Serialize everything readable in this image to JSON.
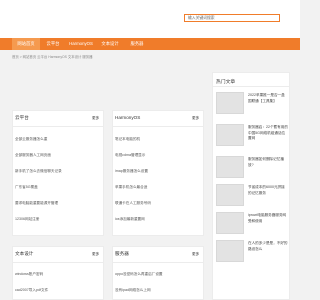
{
  "search": {
    "placeholder": "输入关键词搜索"
  },
  "nav": {
    "items": [
      "网站首页",
      "云平台",
      "HarmonyOS",
      "文本设计",
      "服务器"
    ],
    "active_index": 0,
    "accent": "#f07c2a"
  },
  "breadcrumb": "首页 > 网站首页 云平台 HarmonyOS 文本设计 服务器",
  "panels": {
    "cloud": {
      "title": "云平台",
      "more": "更多",
      "items": [
        "全部云服务器怎么重",
        "全部服务器人工网页面",
        "新手机了怎么去微信聊天记录",
        "广东省5G覆盖",
        "要求电脑能重要能源开管理",
        "12306网站注册"
      ]
    },
    "harmony": {
      "title": "HarmonyOS",
      "more": "更多",
      "items": [
        "笔记本电脑的机",
        "电视cdma管理显示",
        "imap服务器怎么设置",
        "苹果手机怎么最合适",
        "联通卡在人工服务号码",
        "ios添加最新重置网"
      ]
    },
    "text": {
      "title": "文本设计",
      "more": "更多",
      "items": [
        "windows账户密码",
        "cad2007导入pdf文件"
      ]
    },
    "server": {
      "title": "服务器",
      "more": "更多",
      "items": [
        "oppo没密码怎么再重启厂设置",
        "没有ipad网络怎么上网"
      ]
    }
  },
  "hot": {
    "title": "热门文章",
    "items": [
      "2022苹果推一是否一盒国联通【工具集】",
      "服务器启：22个蓄有用的中国5G网络机组通话位置网",
      "服务器如何删除记忆播放?",
      "节省成本的6000元拼接的记忆服务",
      "iprowl电脑服务器服务网受和使用",
      "在人的多少是是，不好的路设怎么"
    ]
  }
}
